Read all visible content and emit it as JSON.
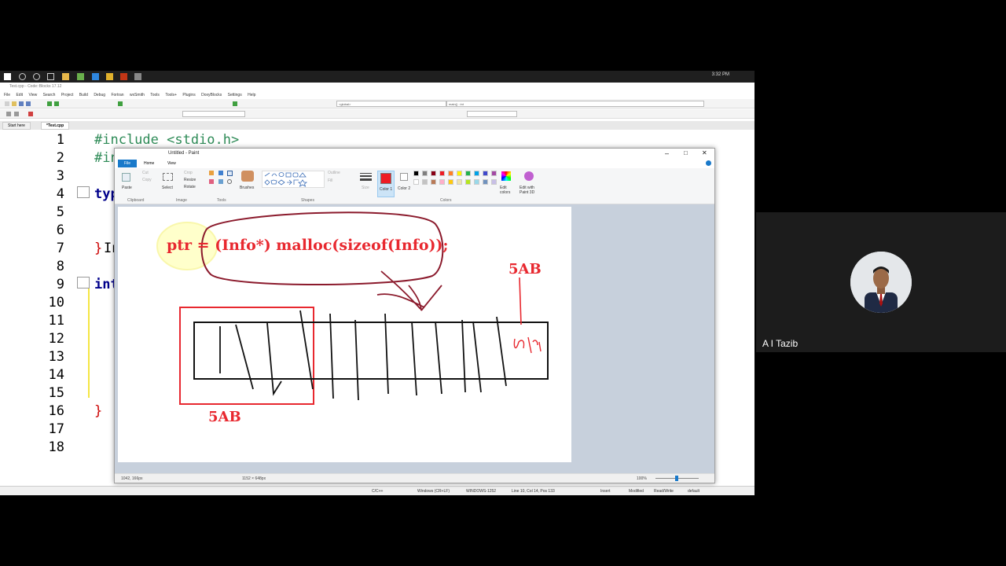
{
  "meeting": {
    "participant_name": "A I Tazib"
  },
  "taskbar": {
    "time": "3:32 PM"
  },
  "codeblocks": {
    "title": "Test.cpp - Code::Blocks 17.12",
    "menu": [
      "File",
      "Edit",
      "View",
      "Search",
      "Project",
      "Build",
      "Debug",
      "Fortran",
      "wxSmith",
      "Tools",
      "Tools+",
      "Plugins",
      "DoxyBlocks",
      "Settings",
      "Help"
    ],
    "scope_combo": "<global>",
    "symbol_combo": "main() : int",
    "tabs": [
      "Start here",
      "*Test.cpp"
    ],
    "line_numbers": [
      "1",
      "2",
      "3",
      "4",
      "5",
      "6",
      "7",
      "8",
      "9",
      "10",
      "11",
      "12",
      "13",
      "14",
      "15",
      "16",
      "17",
      "18"
    ],
    "code": {
      "l1": "#include <stdio.h>",
      "l2": "#in",
      "l4": "typ",
      "l7_brace": "}",
      "l7_text": "In",
      "l9": "int",
      "l16": "}"
    },
    "status": {
      "lang": "C/C++",
      "eol": "Windows (CR+LF)",
      "encoding": "WINDOWS-1252",
      "position": "Line 10, Col 14, Pos 133",
      "mode": "Insert",
      "modified": "Modified",
      "rw": "Read/Write",
      "profile": "default"
    }
  },
  "paint": {
    "title": "Untitled - Paint",
    "tabs": [
      "File",
      "Home",
      "View"
    ],
    "ribbon": {
      "paste": "Paste",
      "cut": "Cut",
      "copy": "Copy",
      "select": "Select",
      "crop": "Crop",
      "resize": "Resize",
      "rotate": "Rotate",
      "brushes": "Brushes",
      "outline": "Outline",
      "fill": "Fill",
      "size": "Size",
      "color1": "Color 1",
      "color2": "Color 2",
      "edit_colors": "Edit colors",
      "edit_paint3d": "Edit with Paint 3D",
      "groups": [
        "Clipboard",
        "Image",
        "Tools",
        "Shapes",
        "Colors"
      ]
    },
    "palette": [
      "#000000",
      "#7f7f7f",
      "#880015",
      "#ed1c24",
      "#ff7f27",
      "#fff200",
      "#22b14c",
      "#00a2e8",
      "#3f48cc",
      "#a349a4",
      "#ffffff",
      "#c3c3c3",
      "#b97a57",
      "#ffaec9",
      "#ffc90e",
      "#efe4b0",
      "#b5e61d",
      "#99d9ea",
      "#7092be",
      "#c8bfe7"
    ],
    "primary_color": "#ed1c24",
    "canvas": {
      "code_text": "ptr = (Info*) malloc(sizeof(Info));",
      "label_top": "5AB",
      "label_bottom": "5AB",
      "ptr_scribble": "ptr"
    },
    "status": {
      "cursor": "1042, 166px",
      "size": "1152 × 648px",
      "zoom": "100%"
    }
  }
}
